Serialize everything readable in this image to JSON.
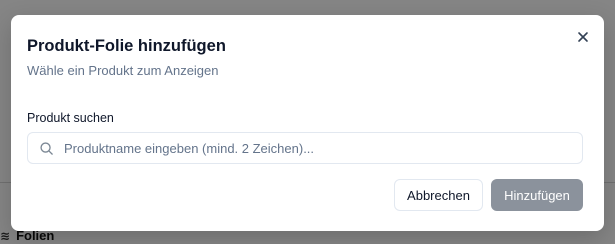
{
  "background": {
    "section_label": "Folien",
    "section_icon": "layers-icon"
  },
  "dialog": {
    "title": "Produkt-Folie hinzufügen",
    "subtitle": "Wähle ein Produkt zum Anzeigen",
    "close_icon": "close-icon",
    "search": {
      "label": "Produkt suchen",
      "placeholder": "Produktname eingeben (mind. 2 Zeichen)...",
      "value": "",
      "icon": "search-icon"
    },
    "actions": {
      "cancel_label": "Abbrechen",
      "add_label": "Hinzufügen",
      "add_disabled": true
    }
  },
  "colors": {
    "overlay": "#000000",
    "primary_disabled": "#8b929c",
    "title": "#0f172a",
    "muted": "#64748b",
    "border": "#e2e8f0"
  }
}
